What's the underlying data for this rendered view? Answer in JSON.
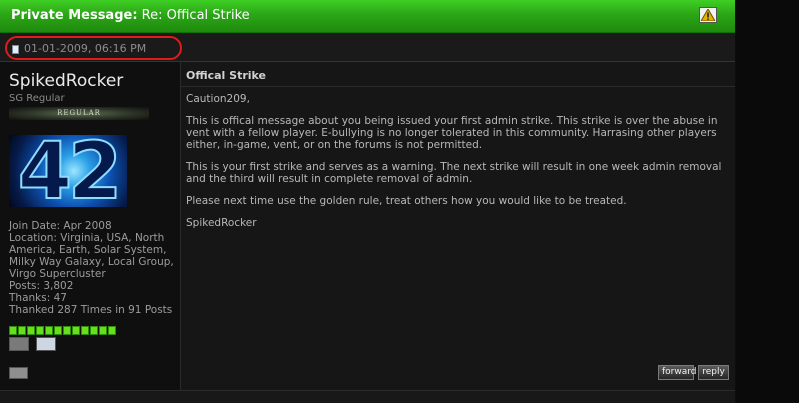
{
  "header": {
    "label": "Private Message:",
    "subject": "Re: Offical Strike"
  },
  "meta": {
    "datetime": "01-01-2009, 06:16 PM"
  },
  "user": {
    "name": "SpikedRocker",
    "title": "SG Regular",
    "rank": "REGULAR",
    "avatar_text": "42",
    "join_date": "Join Date: Apr 2008",
    "location": "Location: Virginia, USA, North America, Earth, Solar System, Milky Way Galaxy, Local Group, Virgo Supercluster",
    "posts": "Posts: 3,802",
    "thanks": "Thanks: 47",
    "thanked": "Thanked 287 Times in 91 Posts",
    "rep_level": 1.0,
    "rep_pips": 12
  },
  "post": {
    "title": "Offical Strike",
    "greeting": "Caution209,",
    "p1": "This is offical message about you being issued your first admin strike. This strike is over the abuse in vent with a fellow player. E-bullying is no longer tolerated in this community. Harrasing other players either, in-game, vent, or on the forums is not permitted.",
    "p2": "This is your first strike and serves as a warning. The next strike will result in one week admin removal and the third will result in complete removal of admin.",
    "p3": "Please next time use the golden rule, treat others how you would like to be treated.",
    "signature": "SpikedRocker"
  },
  "actions": {
    "forward": "forward",
    "reply": "reply"
  },
  "colors": {
    "header_green": "#2ca617",
    "highlight_red": "#e01b1b",
    "rep_green": "#66e01e"
  }
}
